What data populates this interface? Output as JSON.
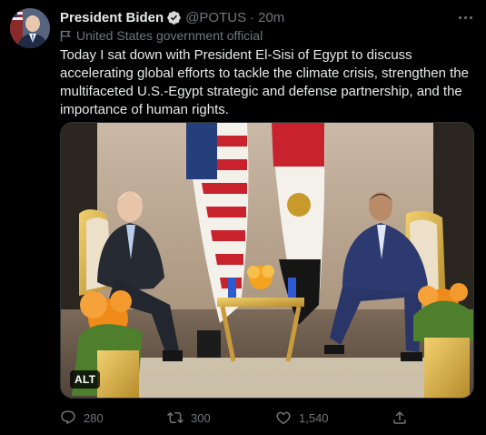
{
  "author": {
    "display_name": "President Biden",
    "handle": "@POTUS",
    "separator": "·",
    "time": "20m",
    "label": "United States government official"
  },
  "tweet": {
    "text": "Today I sat down with President El-Sisi of Egypt to discuss accelerating global efforts to tackle the climate crisis, strengthen the multifaceted U.S.-Egypt strategic and defense partnership, and the importance of human rights."
  },
  "media": {
    "alt_badge": "ALT"
  },
  "actions": {
    "replies": "280",
    "retweets": "300",
    "likes": "1,540"
  },
  "colors": {
    "background": "#000000",
    "text": "#e7e9ea",
    "secondary": "#71767b",
    "border": "#2f3336"
  },
  "icons": [
    "verified-badge-icon",
    "more-options-icon",
    "flag-icon",
    "reply-icon",
    "retweet-icon",
    "like-icon",
    "share-icon"
  ]
}
